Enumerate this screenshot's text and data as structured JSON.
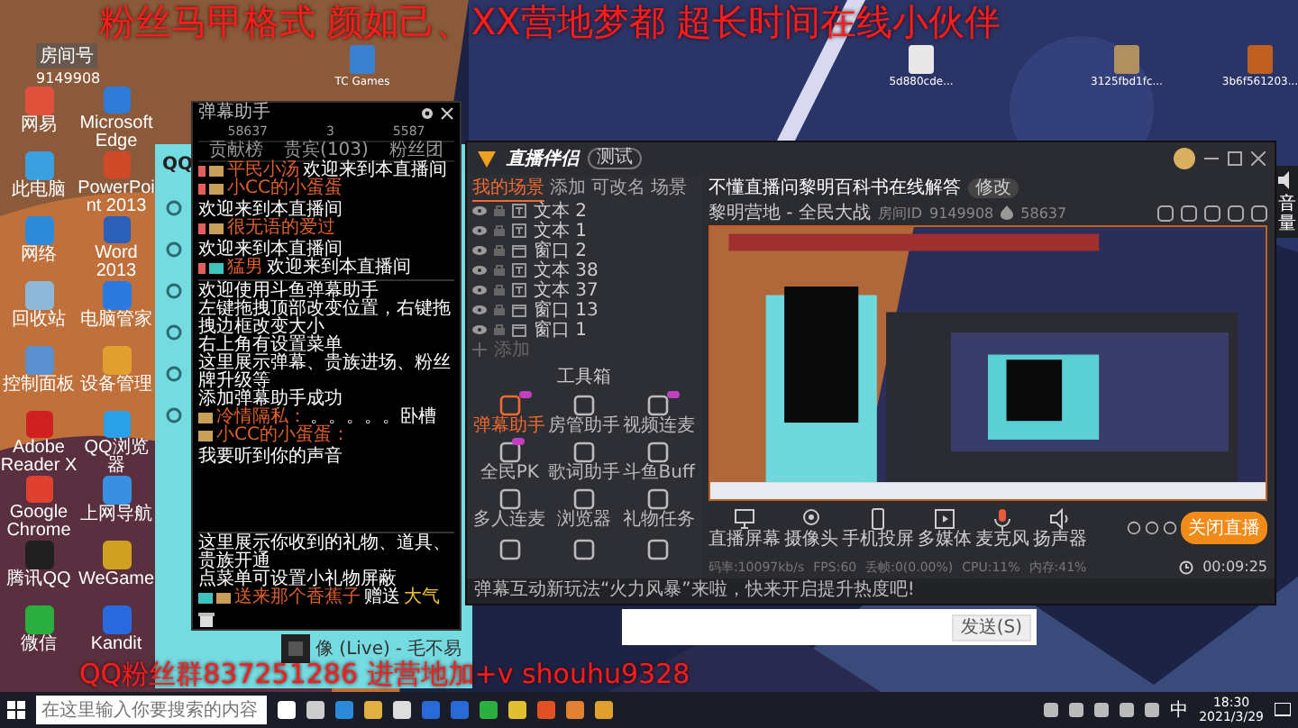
{
  "overlay_text": {
    "top": "粉丝马甲格式 颜如己、XX营地梦都 超长时间在线小伙伴",
    "bottom": "QQ粉丝群837251286    进营地加+v shouhu9328"
  },
  "room_badge": {
    "label": "房间号",
    "number": "9149908"
  },
  "desktop_top_icons": [
    {
      "label": "TC Games"
    },
    {
      "label": "5d880cde..."
    },
    {
      "label": "3125fbd1fc..."
    },
    {
      "label": "3b6f561203..."
    }
  ],
  "desktop_icons": [
    {
      "label": "网易"
    },
    {
      "label": "Microsoft Edge"
    },
    {
      "label": "此电脑"
    },
    {
      "label": "PowerPoint 2013"
    },
    {
      "label": "网络"
    },
    {
      "label": "Word 2013"
    },
    {
      "label": "回收站"
    },
    {
      "label": "电脑管家"
    },
    {
      "label": "控制面板"
    },
    {
      "label": "设备管理"
    },
    {
      "label": "Adobe Reader X"
    },
    {
      "label": "QQ浏览器"
    },
    {
      "label": "Google Chrome"
    },
    {
      "label": "上网导航"
    },
    {
      "label": "腾讯QQ"
    },
    {
      "label": "WeGame"
    },
    {
      "label": "微信"
    },
    {
      "label": "Kandit"
    }
  ],
  "qq_music": {
    "logo": "QQ",
    "player": {
      "song": "像 (Live)",
      "artist": "- 毛不易"
    }
  },
  "danmu": {
    "title": "弹幕助手",
    "stats": [
      "58637",
      "3",
      "5587"
    ],
    "tabs": [
      "贡献榜",
      "贵宾(103)",
      "粉丝团"
    ],
    "welcome": [
      {
        "name": "平民小汤",
        "text": "欢迎来到本直播间",
        "color": "#c9a05a"
      },
      {
        "name": "小CC的小蛋蛋",
        "text": "欢迎来到本直播间",
        "color": "#c9a05a"
      },
      {
        "name": "很无语的爱过",
        "text": "欢迎来到本直播间",
        "color": "#c9a05a"
      },
      {
        "name": "猛男",
        "text": "欢迎来到本直播间",
        "color": "#3fc4c0"
      }
    ],
    "help": [
      "欢迎使用斗鱼弹幕助手",
      "左键拖拽顶部改变位置，右键拖拽边框改变大小",
      "右上角有设置菜单",
      "这里展示弹幕、贵族进场、粉丝牌升级等",
      "添加弹幕助手成功"
    ],
    "chat": [
      {
        "name": "冷情隔私：",
        "text": "。。。。。卧槽"
      },
      {
        "name": "小CC的小蛋蛋：",
        "text": "我要听到你的声音"
      }
    ],
    "gift_help": [
      "这里展示你收到的礼物、道具、贵族开通",
      "点菜单可设置小礼物屏蔽"
    ],
    "gift": {
      "name": "送来那个香蕉子",
      "verb": "赠送",
      "item": "大气"
    }
  },
  "companion": {
    "title": "直播伴侣",
    "mode_button": "测试",
    "scene_tabs": [
      {
        "label": "我的场景",
        "selected": true
      },
      {
        "label": "添加",
        "selected": false
      },
      {
        "label": "可改名",
        "selected": false
      },
      {
        "label": "场景",
        "selected": false
      }
    ],
    "scenes": [
      {
        "kind": "text",
        "name": "文本 2"
      },
      {
        "kind": "text",
        "name": "文本 1"
      },
      {
        "kind": "window",
        "name": "窗口 2"
      },
      {
        "kind": "text",
        "name": "文本 38"
      },
      {
        "kind": "text",
        "name": "文本 37"
      },
      {
        "kind": "window",
        "name": "窗口 13"
      },
      {
        "kind": "window",
        "name": "窗口 1"
      }
    ],
    "add_scene": "添加",
    "toolbox_title": "工具箱",
    "tools": [
      {
        "label": "弹幕助手",
        "active": true,
        "badge": true
      },
      {
        "label": "房管助手",
        "active": false,
        "badge": false
      },
      {
        "label": "视频连麦",
        "active": false,
        "badge": true
      },
      {
        "label": "全民PK",
        "active": false,
        "badge": true
      },
      {
        "label": "歌词助手",
        "active": false,
        "badge": false
      },
      {
        "label": "斗鱼Buff",
        "active": false,
        "badge": false
      },
      {
        "label": "多人连麦",
        "active": false,
        "badge": false
      },
      {
        "label": "浏览器",
        "active": false,
        "badge": false
      },
      {
        "label": "礼物任务",
        "active": false,
        "badge": false
      }
    ],
    "notice": "弹幕互动新玩法“火力风暴”来啦，快来开启提升热度吧!",
    "stream_title": "不懂直播问黎明百科书在线解答",
    "edit_button": "修改",
    "category": "黎明营地 - 全民大战",
    "room_id_label": "房间ID",
    "room_id": "9149908",
    "heat": "58637",
    "controls": [
      {
        "kind": "screen",
        "label": "直播屏幕"
      },
      {
        "kind": "camera",
        "label": "摄像头"
      },
      {
        "kind": "phone",
        "label": "手机投屏"
      },
      {
        "kind": "media",
        "label": "多媒体"
      },
      {
        "kind": "mic",
        "label": "麦克风"
      },
      {
        "kind": "speaker",
        "label": "扬声器"
      }
    ],
    "stop_button": "关闭直播",
    "stats": [
      "码率:10097kb/s",
      "FPS:60",
      "丢帧:0(0.00%)",
      "CPU:11%",
      "内存:41%"
    ],
    "duration": "00:09:25"
  },
  "volume": {
    "label": "音量"
  },
  "chat_input": {
    "send_button": "发送(S)"
  },
  "taskbar": {
    "search_placeholder": "在这里输入你要搜索的内容",
    "ime": "中",
    "time": "18:30",
    "date": "2021/3/29"
  }
}
